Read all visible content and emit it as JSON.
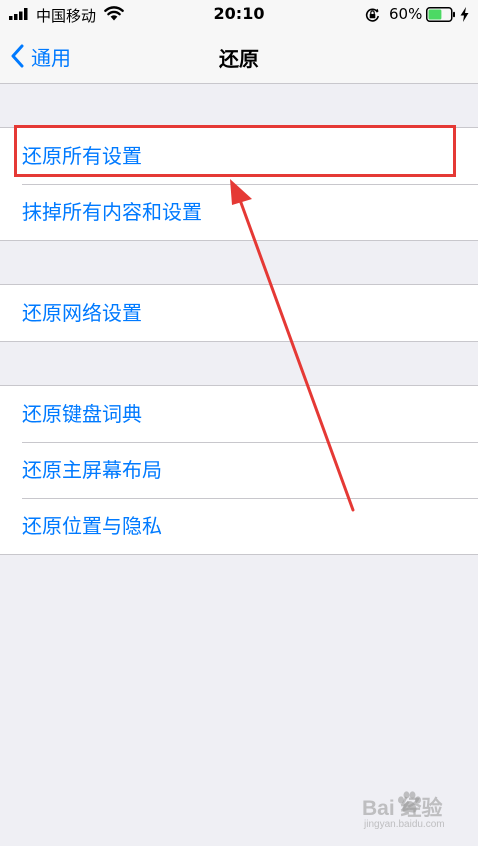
{
  "status_bar": {
    "carrier": "中国移动",
    "time": "20:10",
    "battery_percent": "60%",
    "battery_level": 0.6,
    "icons": [
      "signal-icon",
      "wifi-icon",
      "orientation-lock-icon",
      "battery-icon",
      "charging-bolt-icon"
    ]
  },
  "nav": {
    "back_label": "通用",
    "title": "还原"
  },
  "groups": [
    {
      "items": [
        {
          "label": "还原所有设置"
        },
        {
          "label": "抹掉所有内容和设置"
        }
      ]
    },
    {
      "items": [
        {
          "label": "还原网络设置"
        }
      ]
    },
    {
      "items": [
        {
          "label": "还原键盘词典"
        },
        {
          "label": "还原主屏幕布局"
        },
        {
          "label": "还原位置与隐私"
        }
      ]
    }
  ],
  "annotation": {
    "highlighted_item": "还原所有设置",
    "color": "#e53935"
  },
  "watermark": {
    "main_text": "Bai  经验",
    "sub_text": "jingyan.baidu.com"
  },
  "colors": {
    "accent": "#007aff",
    "background": "#efeff4",
    "separator": "#c8c7cc",
    "battery_fill": "#4cd964"
  }
}
